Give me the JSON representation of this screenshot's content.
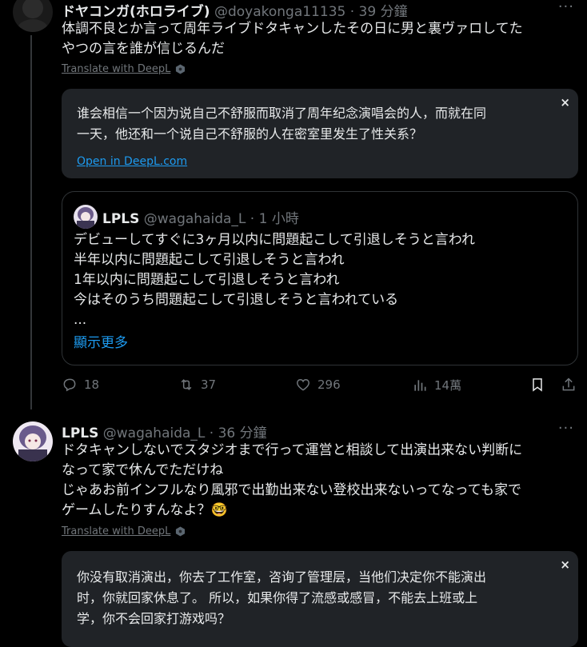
{
  "tweet1": {
    "name": "ドヤコンガ(ホロライブ)",
    "handle": "@doyakonga11135",
    "time": " · 39 分鐘",
    "text_line1": "体調不良とか言って周年ライブドタキャンしたその日に男と裏ヴァロしてた",
    "text_line2": "やつの言を誰が信じるんだ",
    "translate_label": "Translate with DeepL",
    "translation_line1": "谁会相信一个因为说自己不舒服而取消了周年纪念演唱会的人，而就在同",
    "translation_line2": "一天，他还和一个说自己不舒服的人在密室里发生了性关系？",
    "open_link": "Open in DeepL.com",
    "close": "×",
    "quote": {
      "name": "LPLS",
      "handle": "@wagahaida_L",
      "time": " · 1 小時",
      "lines": [
        "デビューしてすぐに3ヶ月以内に問題起こして引退しそうと言われ",
        "半年以内に問題起こして引退しそうと言われ",
        "1年以内に問題起こして引退しそうと言われ",
        "今はそのうち問題起こして引退しそうと言われている",
        "..."
      ],
      "show_more": "顯示更多"
    },
    "actions": {
      "replies": "18",
      "retweets": "37",
      "likes": "296",
      "views": "14萬"
    }
  },
  "tweet2": {
    "name": "LPLS",
    "handle": "@wagahaida_L",
    "time": " · 36 分鐘",
    "text_line1": "ドタキャンしないでスタジオまで行って運営と相談して出演出来ない判断に",
    "text_line2": "なって家で休んでただけね",
    "text_line3": "じゃあお前インフルなり風邪で出勤出来ない登校出来ないってなっても家で",
    "text_line4": "ゲームしたりすんなよ？",
    "emoji": "🤓",
    "translate_label": "Translate with DeepL",
    "translation_line1": "你没有取消演出，你去了工作室，咨询了管理层，当他们决定你不能演出",
    "translation_line2": "时，你就回家休息了。 所以，如果你得了流感或感冒，不能去上班或上",
    "translation_line3": "学，你不会回家打游戏吗？",
    "close": "×"
  },
  "more_glyph": "···",
  "colors": {
    "accent": "#1d9bf0",
    "muted": "#71767b",
    "box": "#202327"
  }
}
